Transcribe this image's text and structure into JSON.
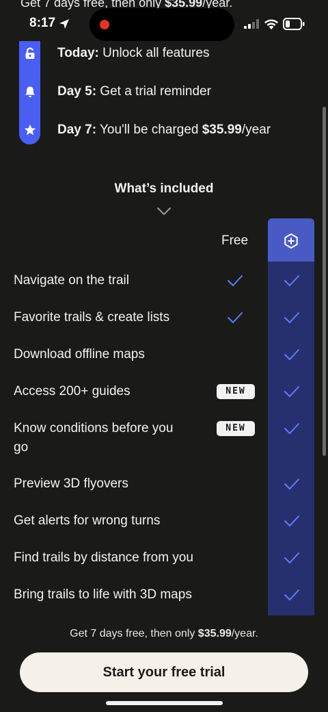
{
  "top_clipped": {
    "prefix": "Get 7 days free, then only ",
    "price": "$35.99",
    "suffix": "/year."
  },
  "status_bar": {
    "time": "8:17",
    "recording_color": "#e5322b"
  },
  "timeline": {
    "accent_color": "#4a5ef2",
    "items": [
      {
        "icon": "unlock-icon",
        "day": "Today:",
        "text": " Unlock all features",
        "price": "",
        "suffix": ""
      },
      {
        "icon": "bell-icon",
        "day": "Day 5:",
        "text": " Get a trial reminder",
        "price": "",
        "suffix": ""
      },
      {
        "icon": "star-icon",
        "day": "Day 7:",
        "text": " You'll be charged ",
        "price": "$35.99",
        "suffix": "/year"
      }
    ]
  },
  "included": {
    "title": "What’s included",
    "free_label": "Free",
    "premium_icon": "plus-badge-icon",
    "badge_label": "NEW",
    "rows": [
      {
        "label": "Navigate on the trail",
        "free": true,
        "premium": true,
        "new": false
      },
      {
        "label": "Favorite trails & create lists",
        "free": true,
        "premium": true,
        "new": false
      },
      {
        "label": "Download offline maps",
        "free": false,
        "premium": true,
        "new": false
      },
      {
        "label": "Access 200+ guides",
        "free": false,
        "premium": true,
        "new": true
      },
      {
        "label": "Know conditions before you go",
        "free": false,
        "premium": true,
        "new": true
      },
      {
        "label": "Preview 3D flyovers",
        "free": false,
        "premium": true,
        "new": false
      },
      {
        "label": "Get alerts for wrong turns",
        "free": false,
        "premium": true,
        "new": false
      },
      {
        "label": "Find trails by distance from you",
        "free": false,
        "premium": true,
        "new": false
      },
      {
        "label": "Bring trails to life with 3D maps",
        "free": false,
        "premium": true,
        "new": false
      }
    ]
  },
  "footer": {
    "note_prefix": "Get 7 days free, then only ",
    "note_price": "$35.99",
    "note_suffix": "/year.",
    "cta_label": "Start your free trial"
  },
  "colors": {
    "background": "#1a1a19",
    "premium_column": "#26306e",
    "premium_header": "#4a5ac4",
    "check": "#5f7cff",
    "cta_background": "#f5f1e8"
  }
}
